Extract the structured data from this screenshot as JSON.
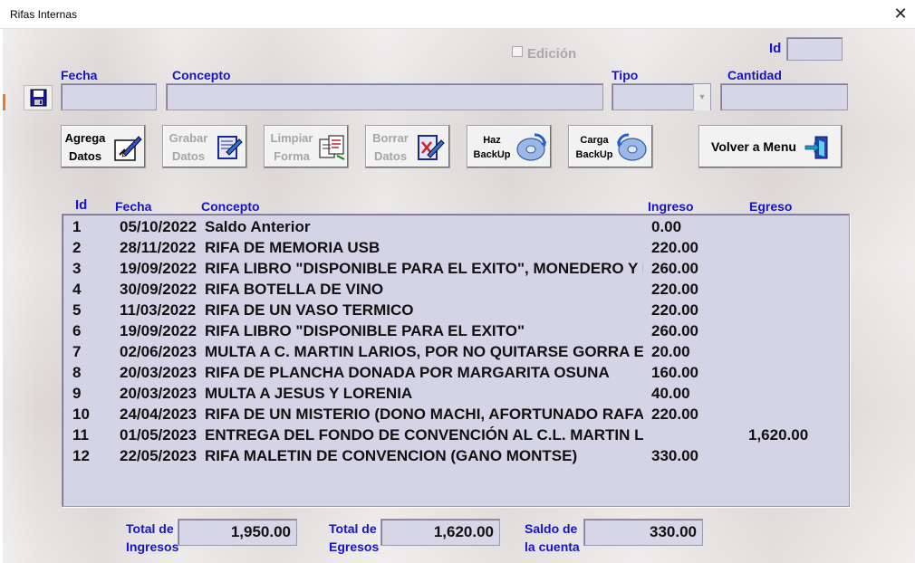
{
  "window": {
    "title": "Rifas Internas",
    "close_glyph": "✕"
  },
  "form": {
    "edicion_label": "Edición",
    "edicion_checked": false,
    "id_label": "Id",
    "id_value": "",
    "fecha_label": "Fecha",
    "fecha_value": "",
    "concepto_label": "Concepto",
    "concepto_value": "",
    "tipo_label": "Tipo",
    "tipo_value": "",
    "cantidad_label": "Cantidad",
    "cantidad_value": ""
  },
  "buttons": {
    "agrega": {
      "line1": "Agrega",
      "line2": "Datos",
      "enabled": true,
      "icon": "pen-paper-icon"
    },
    "grabar": {
      "line1": "Grabar",
      "line2": "Datos",
      "enabled": false,
      "icon": "edit-document-icon"
    },
    "limpiar": {
      "line1": "Limpiar",
      "line2": "Forma",
      "enabled": false,
      "icon": "clear-form-icon"
    },
    "borrar": {
      "line1": "Borrar",
      "line2": "Datos",
      "enabled": false,
      "icon": "delete-document-icon"
    },
    "backup": {
      "line1": "Haz",
      "line2": "BackUp",
      "enabled": true,
      "icon": "backup-disk-icon"
    },
    "carga": {
      "line1": "Carga",
      "line2": "BackUp",
      "enabled": true,
      "icon": "restore-disk-icon"
    },
    "volver": {
      "label": "Volver a Menu",
      "enabled": true,
      "icon": "exit-door-icon"
    }
  },
  "table": {
    "headers": {
      "id": "Id",
      "fecha": "Fecha",
      "concepto": "Concepto",
      "ingreso": "Ingreso",
      "egreso": "Egreso"
    },
    "rows": [
      {
        "id": "1",
        "fecha": "05/10/2022",
        "concepto": "Saldo Anterior",
        "ingreso": "0.00",
        "egreso": ""
      },
      {
        "id": "2",
        "fecha": "28/11/2022",
        "concepto": "RIFA DE MEMORIA USB",
        "ingreso": "220.00",
        "egreso": ""
      },
      {
        "id": "3",
        "fecha": "19/09/2022",
        "concepto": "RIFA LIBRO \"DISPONIBLE PARA EL EXITO\", MONEDERO Y PLUMA",
        "ingreso": "260.00",
        "egreso": ""
      },
      {
        "id": "4",
        "fecha": "30/09/2022",
        "concepto": "RIFA BOTELLA DE VINO",
        "ingreso": "220.00",
        "egreso": ""
      },
      {
        "id": "5",
        "fecha": "11/03/2022",
        "concepto": "RIFA DE UN VASO TERMICO",
        "ingreso": "220.00",
        "egreso": ""
      },
      {
        "id": "6",
        "fecha": "19/09/2022",
        "concepto": "RIFA LIBRO \"DISPONIBLE PARA EL EXITO\"",
        "ingreso": "260.00",
        "egreso": ""
      },
      {
        "id": "7",
        "fecha": "02/06/2023",
        "concepto": "MULTA A C. MARTIN LARIOS, POR NO QUITARSE GORRA EN HONORES",
        "ingreso": "20.00",
        "egreso": ""
      },
      {
        "id": "8",
        "fecha": "20/03/2023",
        "concepto": "RIFA DE PLANCHA  DONADA POR MARGARITA OSUNA",
        "ingreso": "160.00",
        "egreso": ""
      },
      {
        "id": "9",
        "fecha": "20/03/2023",
        "concepto": "MULTA A JESUS Y LORENIA",
        "ingreso": "40.00",
        "egreso": ""
      },
      {
        "id": "10",
        "fecha": "24/04/2023",
        "concepto": "RIFA DE UN MISTERIO (DONO MACHI, AFORTUNADO RAFAEL)",
        "ingreso": "220.00",
        "egreso": ""
      },
      {
        "id": "11",
        "fecha": "01/05/2023",
        "concepto": "ENTREGA DEL FONDO DE CONVENCIÓN AL C.L. MARTIN LARIOS",
        "ingreso": "",
        "egreso": "1,620.00"
      },
      {
        "id": "12",
        "fecha": "22/05/2023",
        "concepto": "RIFA MALETIN DE CONVENCION  (GANO MONTSE)",
        "ingreso": "330.00",
        "egreso": ""
      }
    ]
  },
  "totals": {
    "ingresos_label_1": "Total de",
    "ingresos_label_2": "Ingresos",
    "ingresos_value": "1,950.00",
    "egresos_label_1": "Total de",
    "egresos_label_2": "Egresos",
    "egresos_value": "1,620.00",
    "saldo_label_1": "Saldo de",
    "saldo_label_2": "la cuenta",
    "saldo_value": "330.00"
  },
  "colors": {
    "label_blue": "#1414c8",
    "field_bg": "#d7d6e6",
    "list_bg": "#d5d4e6",
    "disabled_text": "#a6a6a6"
  }
}
